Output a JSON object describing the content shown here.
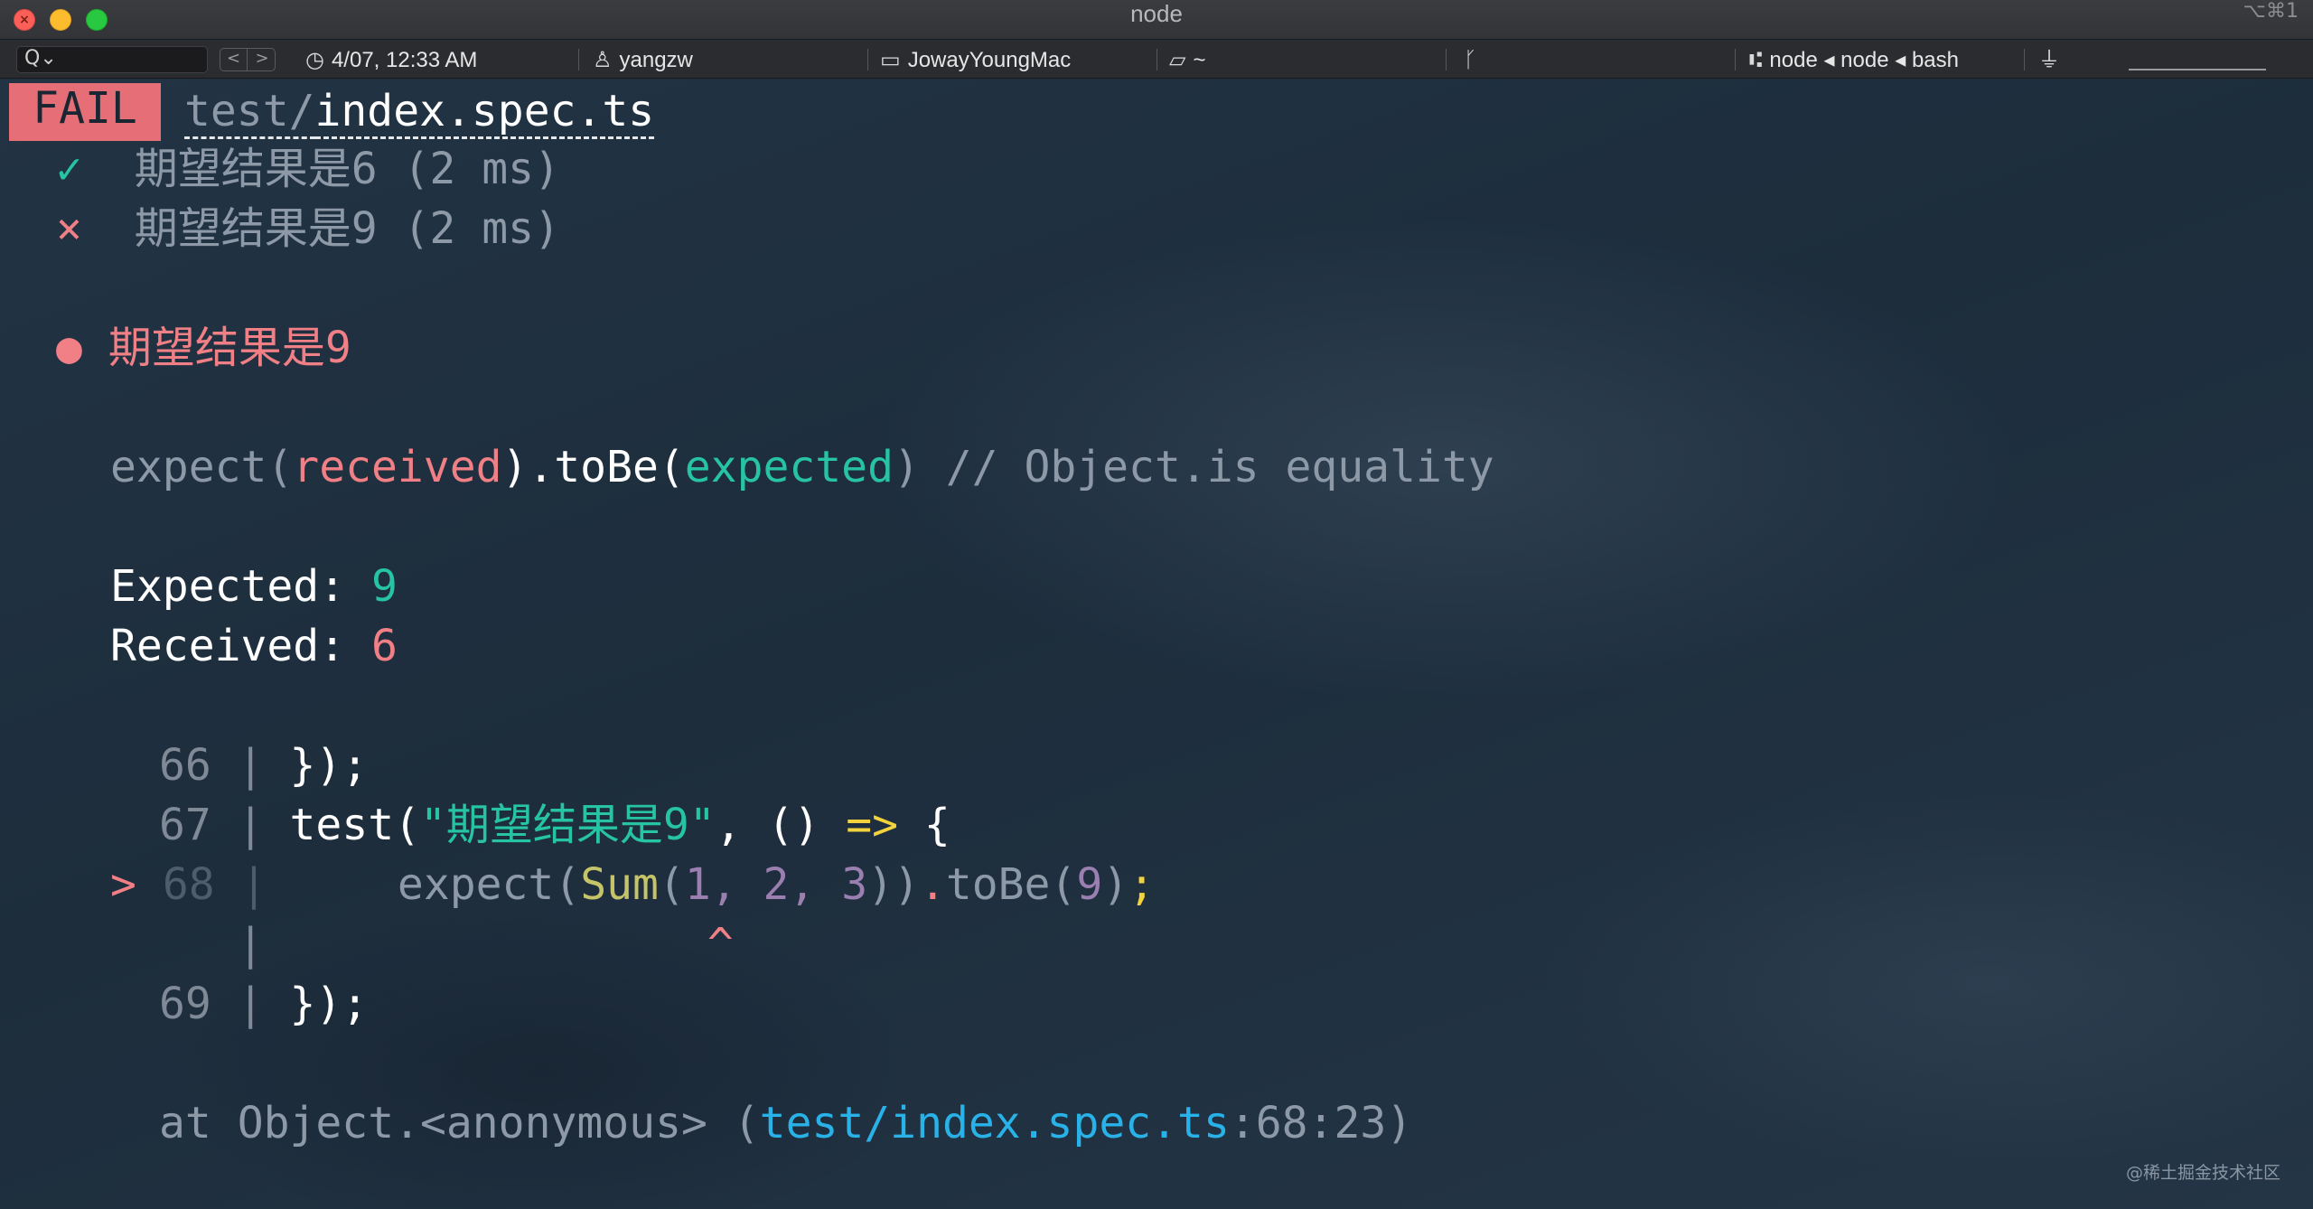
{
  "window": {
    "title": "node",
    "shortcut": "⌥⌘1"
  },
  "statusbar": {
    "search_glyph": "Q⌄",
    "nav_prev": "<",
    "nav_next": ">",
    "datetime": "4/07, 12:33 AM",
    "user": "yangzw",
    "host": "JowayYoungMac",
    "directory": "~",
    "jobs": "node ◂ node ◂ bash",
    "icons": {
      "datetime": "clock-icon",
      "user": "user-icon",
      "host": "laptop-icon",
      "directory": "folder-icon",
      "git": "git-branch-icon",
      "jobs": "process-tree-icon",
      "power": "plug-icon"
    }
  },
  "terminal": {
    "fail_badge": "FAIL",
    "file_dir": "test/",
    "file_name": "index.spec.ts",
    "results": [
      {
        "mark": "✓",
        "name": "期望结果是6",
        "time": " (2 ms)"
      },
      {
        "mark": "×",
        "name": "期望结果是9",
        "time": " (2 ms)"
      }
    ],
    "failed_test_bullet": "●",
    "failed_test_name": "期望结果是9",
    "matcher": {
      "expect": "expect(",
      "received": "received",
      "to_be": ").toBe(",
      "expected": "expected",
      "comment": ") // Object.is equality"
    },
    "expected_label": "Expected: ",
    "expected_value": "9",
    "received_label": "Received: ",
    "received_value": "6",
    "code": {
      "pipe": "|",
      "pointer": ">",
      "caret": "^",
      "l66_num": "66",
      "l66_text": "});",
      "l67_num": "67",
      "l67_test": "test(",
      "l67_str": "\"期望结果是9\"",
      "l67_comma": ", () ",
      "l67_arrow": "=>",
      "l67_brace": " {",
      "l68_num": "68",
      "l68_expect": "expect(",
      "l68_sum": "Sum",
      "l68_paren": "(",
      "l68_args": "1, 2, 3",
      "l68_close": "))",
      "l68_dot": ".",
      "l68_tobe": "toBe(",
      "l68_nine": "9",
      "l68_end": ")",
      "l68_semi": ";",
      "l69_num": "69",
      "l69_text": "});"
    },
    "stack": {
      "prefix": "at Object.<anonymous> (",
      "path": "test/index.spec.ts",
      "loc": ":68:23)"
    }
  },
  "watermark": "@稀土掘金技术社区"
}
